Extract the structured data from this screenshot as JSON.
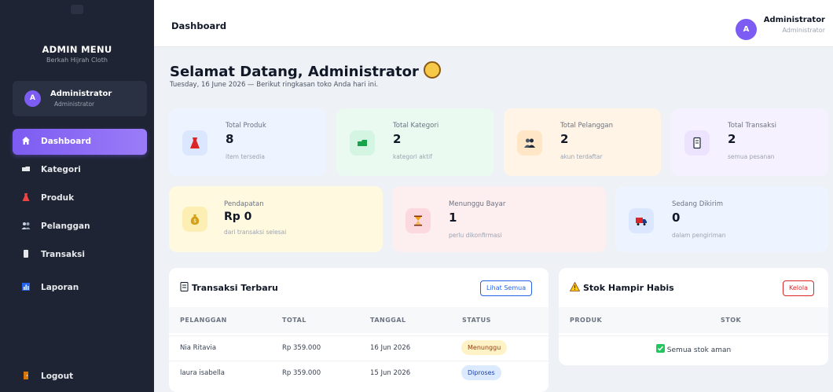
{
  "sidebar": {
    "title": "ADMIN MENU",
    "subtitle": "Berkah Hijrah Cloth",
    "user": {
      "avatar_letter": "A",
      "name": "Administrator",
      "role": "Administrator"
    },
    "items": [
      {
        "label": "Dashboard",
        "icon": "home-icon",
        "active": true
      },
      {
        "label": "Kategori",
        "icon": "tag-icon"
      },
      {
        "label": "Produk",
        "icon": "dress-icon"
      },
      {
        "label": "Pelanggan",
        "icon": "users-icon"
      },
      {
        "label": "Transaksi",
        "icon": "receipt-icon"
      },
      {
        "label": "Laporan",
        "icon": "bar-chart-icon"
      }
    ],
    "logout_label": "Logout"
  },
  "topbar": {
    "title": "Dashboard",
    "user": {
      "avatar_letter": "A",
      "name": "Administrator",
      "role": "Administrator"
    }
  },
  "welcome": {
    "title": "Selamat Datang, Administrator",
    "subtitle": "Tuesday, 16 June 2026 — Berikut ringkasan toko Anda hari ini."
  },
  "stats_row1": [
    {
      "label": "Total Produk",
      "value": "8",
      "note": "item tersedia",
      "icon": "dress-icon",
      "bg": "#eef4ff",
      "icon_bg": "#dbe7ff"
    },
    {
      "label": "Total Kategori",
      "value": "2",
      "note": "kategori aktif",
      "icon": "tag-icon",
      "bg": "#eafaf1",
      "icon_bg": "#d4f5e2"
    },
    {
      "label": "Total Pelanggan",
      "value": "2",
      "note": "akun terdaftar",
      "icon": "users-icon",
      "bg": "#fff4e6",
      "icon_bg": "#ffe6c7"
    },
    {
      "label": "Total Transaksi",
      "value": "2",
      "note": "semua pesanan",
      "icon": "receipt-icon",
      "bg": "#f6f1ff",
      "icon_bg": "#ece3ff"
    }
  ],
  "stats_row2": [
    {
      "label": "Pendapatan",
      "value": "Rp 0",
      "note": "dari transaksi selesai",
      "icon": "money-bag-icon",
      "bg": "#fff9e0",
      "icon_bg": "#fdeeb3"
    },
    {
      "label": "Menunggu Bayar",
      "value": "1",
      "note": "perlu dikonfirmasi",
      "icon": "hourglass-icon",
      "bg": "#fdeef0",
      "icon_bg": "#fbd9de"
    },
    {
      "label": "Sedang Dikirim",
      "value": "0",
      "note": "dalam pengiriman",
      "icon": "truck-icon",
      "bg": "#eef4ff",
      "icon_bg": "#dbe7ff"
    }
  ],
  "transactions": {
    "title": "Transaksi Terbaru",
    "button": "Lihat Semua",
    "columns": [
      "PELANGGAN",
      "TOTAL",
      "TANGGAL",
      "STATUS"
    ],
    "rows": [
      {
        "customer": "Nia Ritavia",
        "total": "Rp 359.000",
        "date": "16 Jun 2026",
        "status": "Menunggu",
        "status_bg": "#fef3c7",
        "status_color": "#92400e"
      },
      {
        "customer": "laura isabella",
        "total": "Rp 359.000",
        "date": "15 Jun 2026",
        "status": "Diproses",
        "status_bg": "#dbeafe",
        "status_color": "#1e40af"
      }
    ]
  },
  "stock": {
    "title": "Stok Hampir Habis",
    "button": "Kelola",
    "columns": [
      "PRODUK",
      "STOK"
    ],
    "empty_message": "Semua stok aman"
  },
  "colors": {
    "accent": "#7c5cf2",
    "sidebar_bg": "#1e2433",
    "page_bg": "#eef1f6"
  }
}
